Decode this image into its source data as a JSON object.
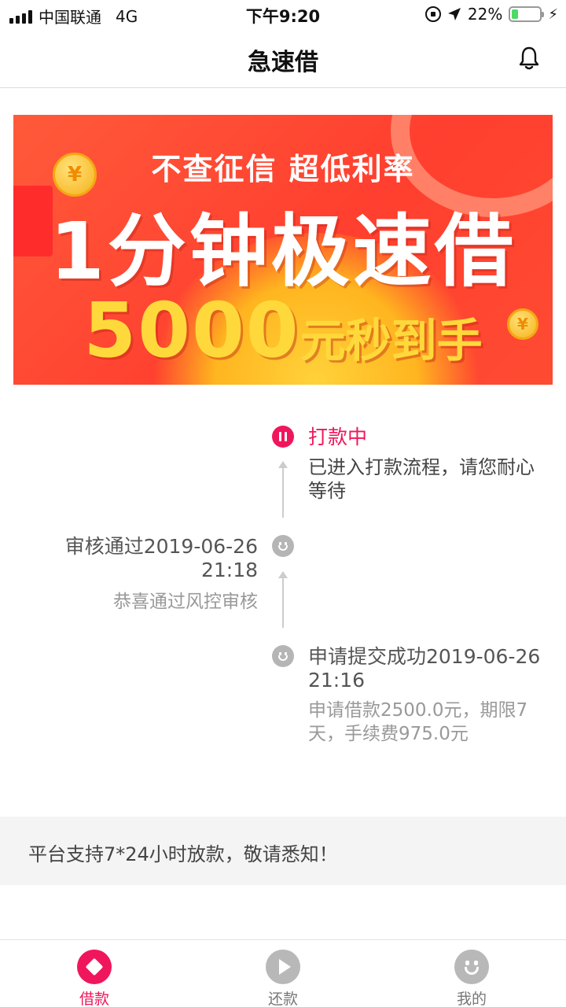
{
  "status_bar": {
    "carrier": "中国联通",
    "network": "4G",
    "time": "下午9:20",
    "battery_text": "22%",
    "battery_level": 0.22,
    "icons": [
      "signal-icon",
      "rotation-lock-icon",
      "location-arrow-icon",
      "battery-icon",
      "charging-bolt-icon"
    ]
  },
  "nav": {
    "title": "急速借",
    "icon": "bell-icon"
  },
  "banner": {
    "line1": "不查征信 超低利率",
    "line2": "1分钟极速借",
    "amount": "5000",
    "suffix": "元秒到手",
    "coin_symbol": "¥"
  },
  "timeline": [
    {
      "title": "打款中",
      "desc": "已进入打款流程，请您耐心等待",
      "status": "active",
      "icon": "pause-icon",
      "color": "#f0165c"
    },
    {
      "title": "审核通过2019-06-26 21:18",
      "desc": "恭喜通过风控审核",
      "status": "done",
      "icon": "smile-icon"
    },
    {
      "title": "申请提交成功2019-06-26 21:16",
      "desc": "申请借款2500.0元，期限7天，手续费975.0元",
      "status": "done",
      "icon": "smile-icon"
    }
  ],
  "notice": {
    "text": "平台支持7*24小时放款，敬请悉知！"
  },
  "tabs": [
    {
      "label": "借款",
      "icon": "loan-diamond-icon",
      "active": true
    },
    {
      "label": "还款",
      "icon": "play-circle-icon",
      "active": false
    },
    {
      "label": "我的",
      "icon": "smiley-profile-icon",
      "active": false
    }
  ],
  "colors": {
    "accent": "#f0165c",
    "inactive": "#b8b8b8",
    "banner_red": "#ff4a32",
    "banner_yellow": "#ffd93b"
  }
}
